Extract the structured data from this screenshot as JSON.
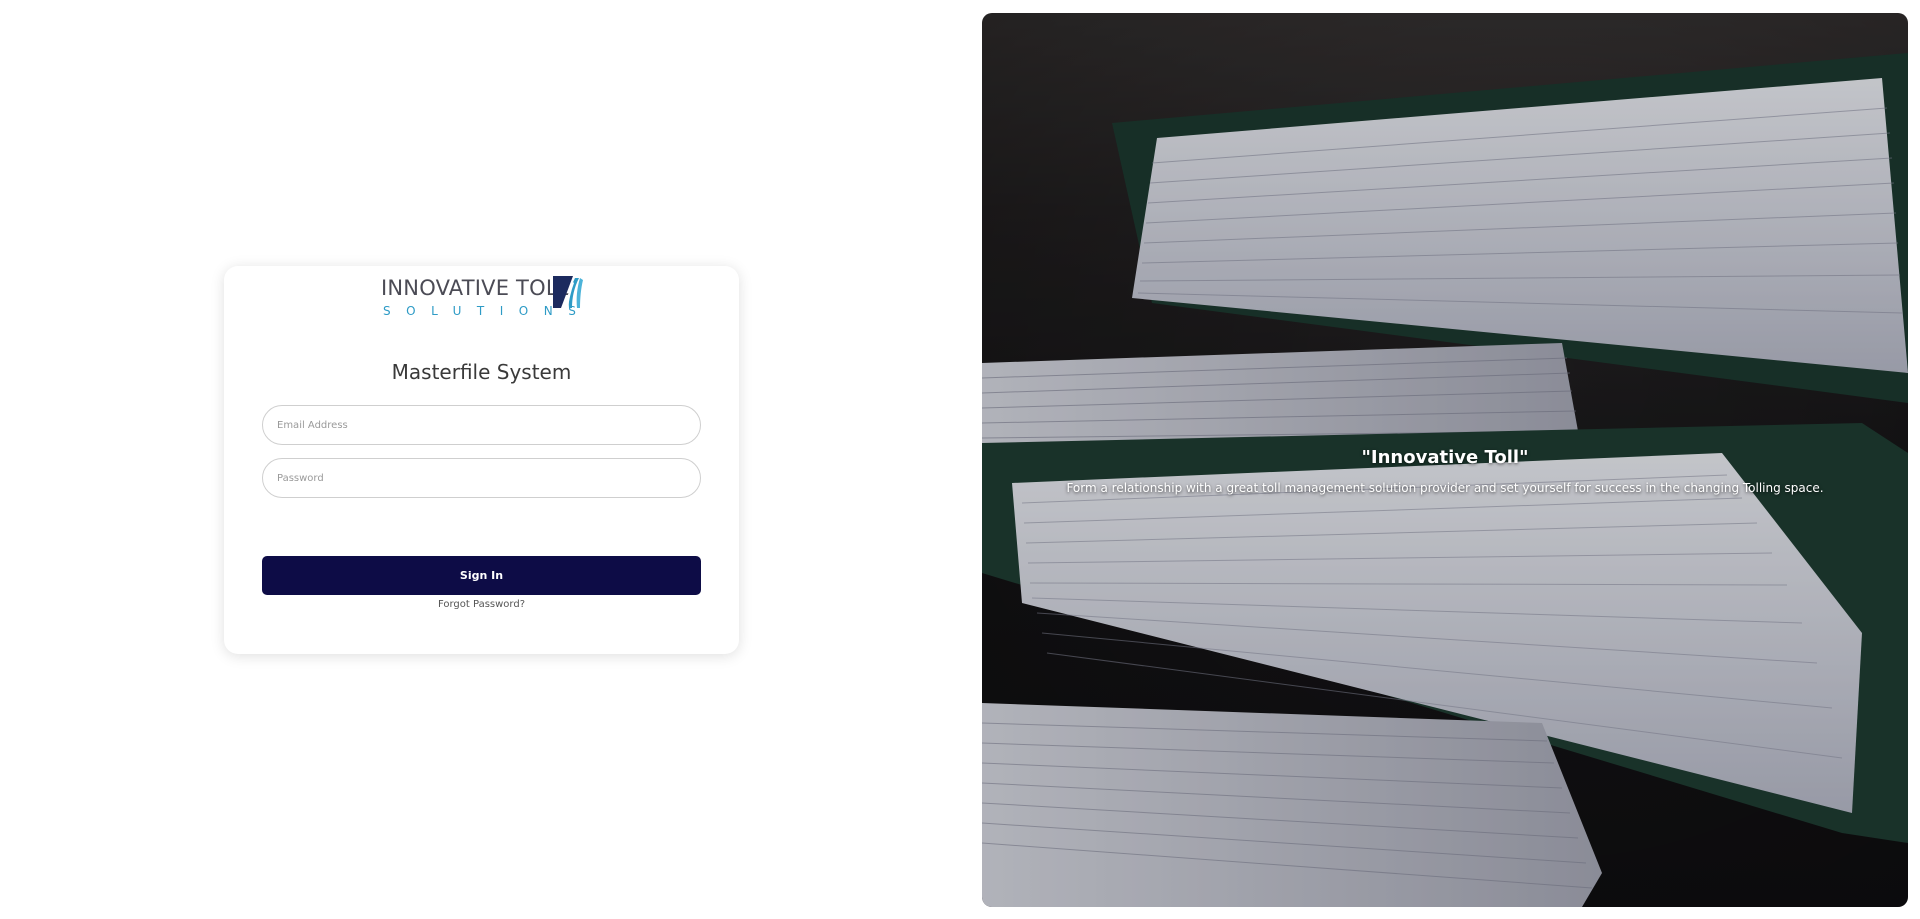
{
  "login": {
    "logo_text_main": "INNOVATIVE TOLL",
    "logo_text_sub": "SOLUTIONS",
    "title": "Masterfile System",
    "email_placeholder": "Email Address",
    "email_value": "",
    "password_placeholder": "Password",
    "password_value": "",
    "signin_label": "Sign In",
    "forgot_label": "Forgot Password?"
  },
  "hero": {
    "image": "binders-of-paper-stacks-photo",
    "title": "\"Innovative Toll\"",
    "subtitle": "Form a relationship with a great toll management solution provider and set yourself for success in the changing Tolling space."
  },
  "colors": {
    "button_bg": "#0d0c46",
    "logo_navy": "#1c2a5e",
    "logo_blue": "#2e9bc6",
    "card_bg": "#ffffff"
  }
}
